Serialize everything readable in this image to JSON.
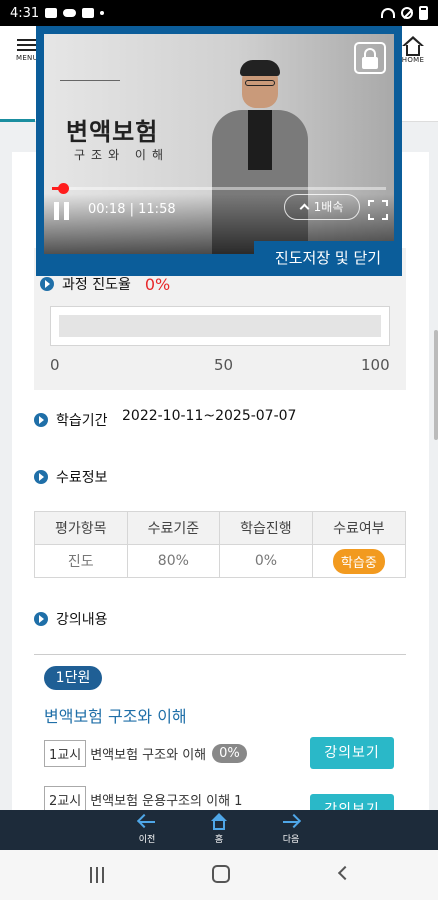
{
  "status_bar": {
    "time": "4:31"
  },
  "header": {
    "menu_label": "MENU",
    "home_label": "HOME"
  },
  "video": {
    "slide_title": "변액보험",
    "slide_subtitle": "구조와 이해",
    "current_time": "00:18",
    "duration": "11:58",
    "time_separator": "|",
    "played_fraction": 0.025,
    "speed_label": "1배속",
    "save_close_label": "진도저장 및 닫기"
  },
  "progress": {
    "label": "과정 진도율",
    "value_text": "0%",
    "value": 0,
    "scale": [
      "0",
      "50",
      "100"
    ]
  },
  "period": {
    "label": "학습기간",
    "value": "2022-10-11~2025-07-07"
  },
  "completion": {
    "label": "수료정보",
    "headers": [
      "평가항목",
      "수료기준",
      "학습진행",
      "수료여부"
    ],
    "row": {
      "item": "진도",
      "criteria": "80%",
      "progress": "0%",
      "status": "학습중"
    }
  },
  "lecture": {
    "label": "강의내용",
    "unit_badge": "1단원",
    "unit_title": "변액보험 구조와 이해",
    "lessons": [
      {
        "num": "1교시",
        "title": "변액보험 구조와 이해",
        "percent": "0%",
        "button": "강의보기"
      },
      {
        "num": "2교시",
        "title": "변액보험 운용구조의 이해 1",
        "button": "강의보기"
      }
    ]
  },
  "bottom_nav": {
    "prev": "이전",
    "home": "홈",
    "next": "다음"
  },
  "colors": {
    "accent_blue": "#0b5d9a",
    "teal_button": "#2ab8c8",
    "red": "#e8282b",
    "orange": "#f29a1f"
  }
}
